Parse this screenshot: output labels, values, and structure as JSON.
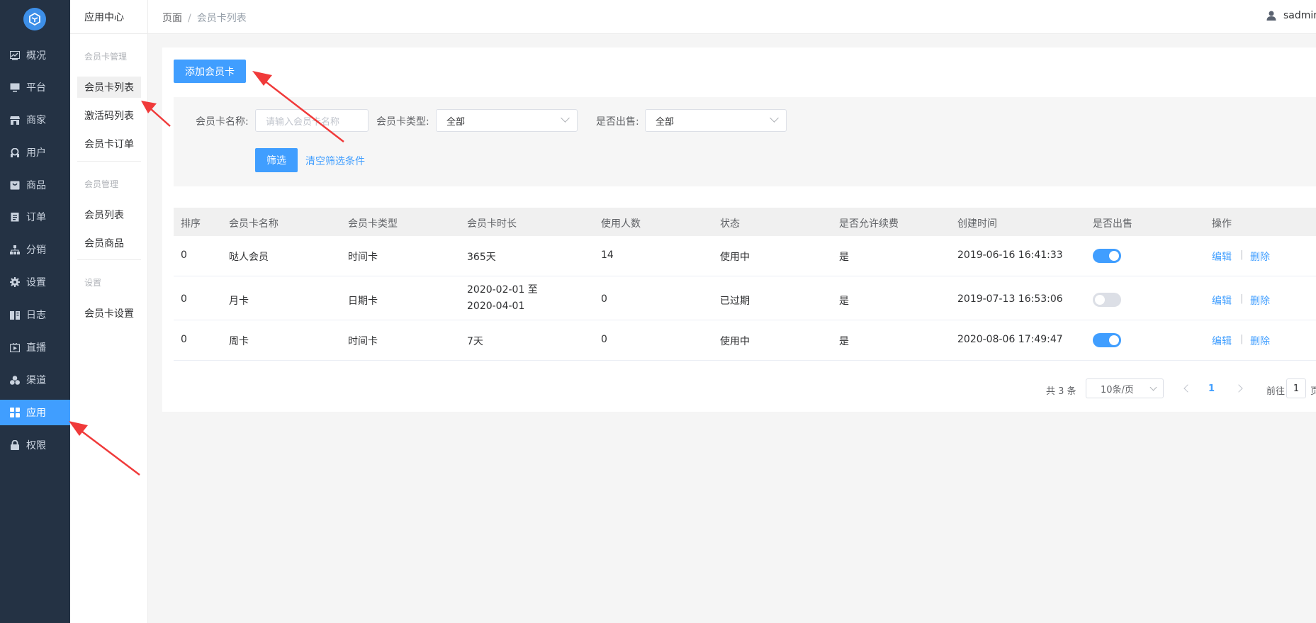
{
  "sidebar": {
    "items": [
      {
        "label": "概况",
        "icon": "chart-icon"
      },
      {
        "label": "平台",
        "icon": "monitor-icon"
      },
      {
        "label": "商家",
        "icon": "store-icon"
      },
      {
        "label": "用户",
        "icon": "user-icon"
      },
      {
        "label": "商品",
        "icon": "goods-icon"
      },
      {
        "label": "订单",
        "icon": "order-icon"
      },
      {
        "label": "分销",
        "icon": "share-icon"
      },
      {
        "label": "设置",
        "icon": "gear-icon"
      },
      {
        "label": "日志",
        "icon": "book-icon"
      },
      {
        "label": "直播",
        "icon": "live-icon"
      },
      {
        "label": "渠道",
        "icon": "channel-icon"
      },
      {
        "label": "应用",
        "icon": "grid-icon",
        "active": true
      },
      {
        "label": "权限",
        "icon": "lock-icon"
      }
    ]
  },
  "submenu": {
    "title": "应用中心",
    "group1": "会员卡管理",
    "item_card_list": "会员卡列表",
    "item_code_list": "激活码列表",
    "item_card_orders": "会员卡订单",
    "group2": "会员管理",
    "item_member_list": "会员列表",
    "item_member_goods": "会员商品",
    "group3": "设置",
    "item_card_settings": "会员卡设置"
  },
  "header": {
    "crumb_root": "页面",
    "crumb_sep": "/",
    "crumb_current": "会员卡列表",
    "username": "sadmin"
  },
  "toolbar": {
    "add_label": "添加会员卡"
  },
  "filter": {
    "name_label": "会员卡名称:",
    "name_placeholder": "请输入会员卡名称",
    "type_label": "会员卡类型:",
    "type_value": "全部",
    "sale_label": "是否出售:",
    "sale_value": "全部",
    "submit_label": "筛选",
    "clear_label": "清空筛选条件"
  },
  "table": {
    "headers": [
      "排序",
      "会员卡名称",
      "会员卡类型",
      "会员卡时长",
      "使用人数",
      "状态",
      "是否允许续费",
      "创建时间",
      "是否出售",
      "操作"
    ],
    "rows": [
      {
        "sort": "0",
        "name": "哒人会员",
        "type": "时间卡",
        "duration1": "365天",
        "duration2": "",
        "users": "14",
        "status": "使用中",
        "renew": "是",
        "created": "2019-06-16 16:41:33",
        "on_sale": true,
        "edit": "编辑",
        "delete": "删除"
      },
      {
        "sort": "0",
        "name": "月卡",
        "type": "日期卡",
        "duration1": "2020-02-01 至",
        "duration2": "2020-04-01",
        "users": "0",
        "status": "已过期",
        "renew": "是",
        "created": "2019-07-13 16:53:06",
        "on_sale": false,
        "edit": "编辑",
        "delete": "删除"
      },
      {
        "sort": "0",
        "name": "周卡",
        "type": "时间卡",
        "duration1": "7天",
        "duration2": "",
        "users": "0",
        "status": "使用中",
        "renew": "是",
        "created": "2020-08-06 17:49:47",
        "on_sale": true,
        "edit": "编辑",
        "delete": "删除"
      }
    ],
    "op_sep": "|"
  },
  "pager": {
    "total": "共 3 条",
    "page_size": "10条/页",
    "current_page": "1",
    "goto_label": "前往",
    "goto_value": "1",
    "goto_suffix": "页"
  },
  "colors": {
    "sidebar_bg": "#243244",
    "accent": "#409eff",
    "annotation_arrow": "#f03a3a"
  }
}
